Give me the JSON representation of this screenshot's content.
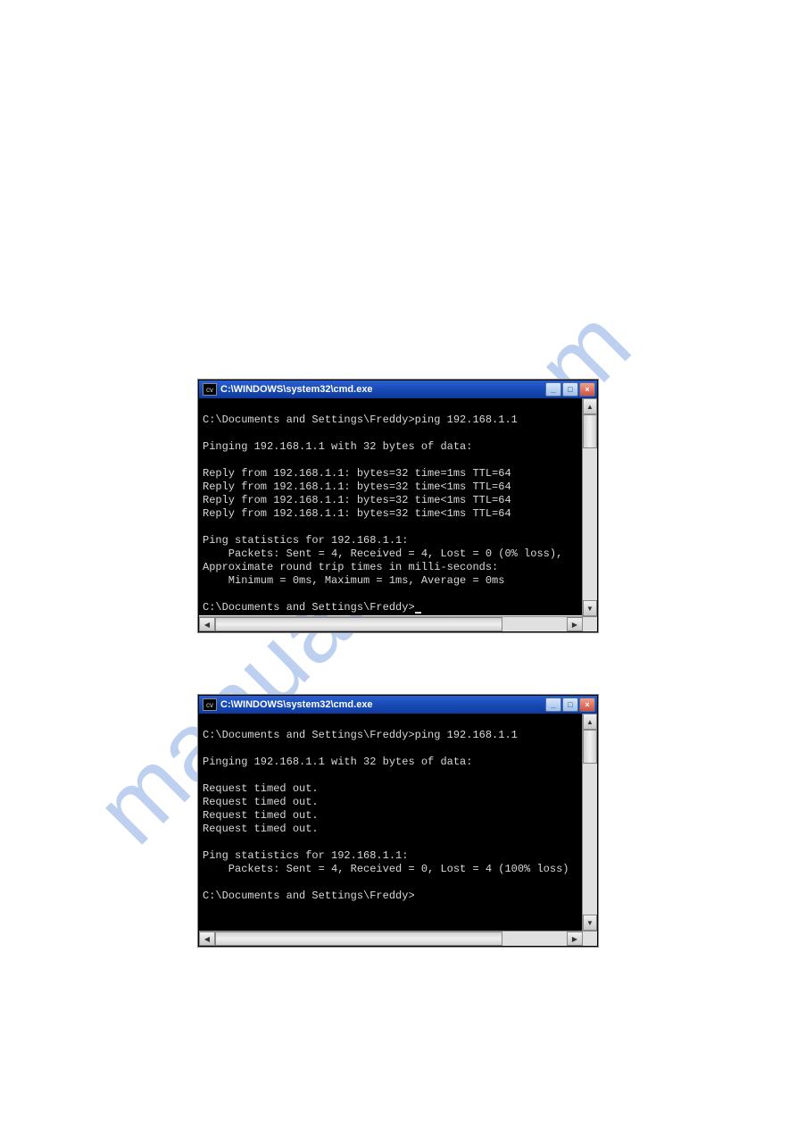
{
  "watermark": "manualslib.com",
  "window1": {
    "title": "C:\\WINDOWS\\system32\\cmd.exe",
    "icon_label": "cv",
    "lines": [
      "",
      "C:\\Documents and Settings\\Freddy>ping 192.168.1.1",
      "",
      "Pinging 192.168.1.1 with 32 bytes of data:",
      "",
      "Reply from 192.168.1.1: bytes=32 time=1ms TTL=64",
      "Reply from 192.168.1.1: bytes=32 time<1ms TTL=64",
      "Reply from 192.168.1.1: bytes=32 time<1ms TTL=64",
      "Reply from 192.168.1.1: bytes=32 time<1ms TTL=64",
      "",
      "Ping statistics for 192.168.1.1:",
      "    Packets: Sent = 4, Received = 4, Lost = 0 (0% loss),",
      "Approximate round trip times in milli-seconds:",
      "    Minimum = 0ms, Maximum = 1ms, Average = 0ms",
      "",
      "C:\\Documents and Settings\\Freddy>"
    ]
  },
  "window2": {
    "title": "C:\\WINDOWS\\system32\\cmd.exe",
    "icon_label": "cv",
    "lines": [
      "",
      "C:\\Documents and Settings\\Freddy>ping 192.168.1.1",
      "",
      "Pinging 192.168.1.1 with 32 bytes of data:",
      "",
      "Request timed out.",
      "Request timed out.",
      "Request timed out.",
      "Request timed out.",
      "",
      "Ping statistics for 192.168.1.1:",
      "    Packets: Sent = 4, Received = 0, Lost = 4 (100% loss)",
      "",
      "C:\\Documents and Settings\\Freddy>"
    ]
  },
  "controls": {
    "minimize": "_",
    "maximize": "□",
    "close": "×",
    "up": "▲",
    "down": "▼",
    "left": "◀",
    "right": "▶"
  }
}
